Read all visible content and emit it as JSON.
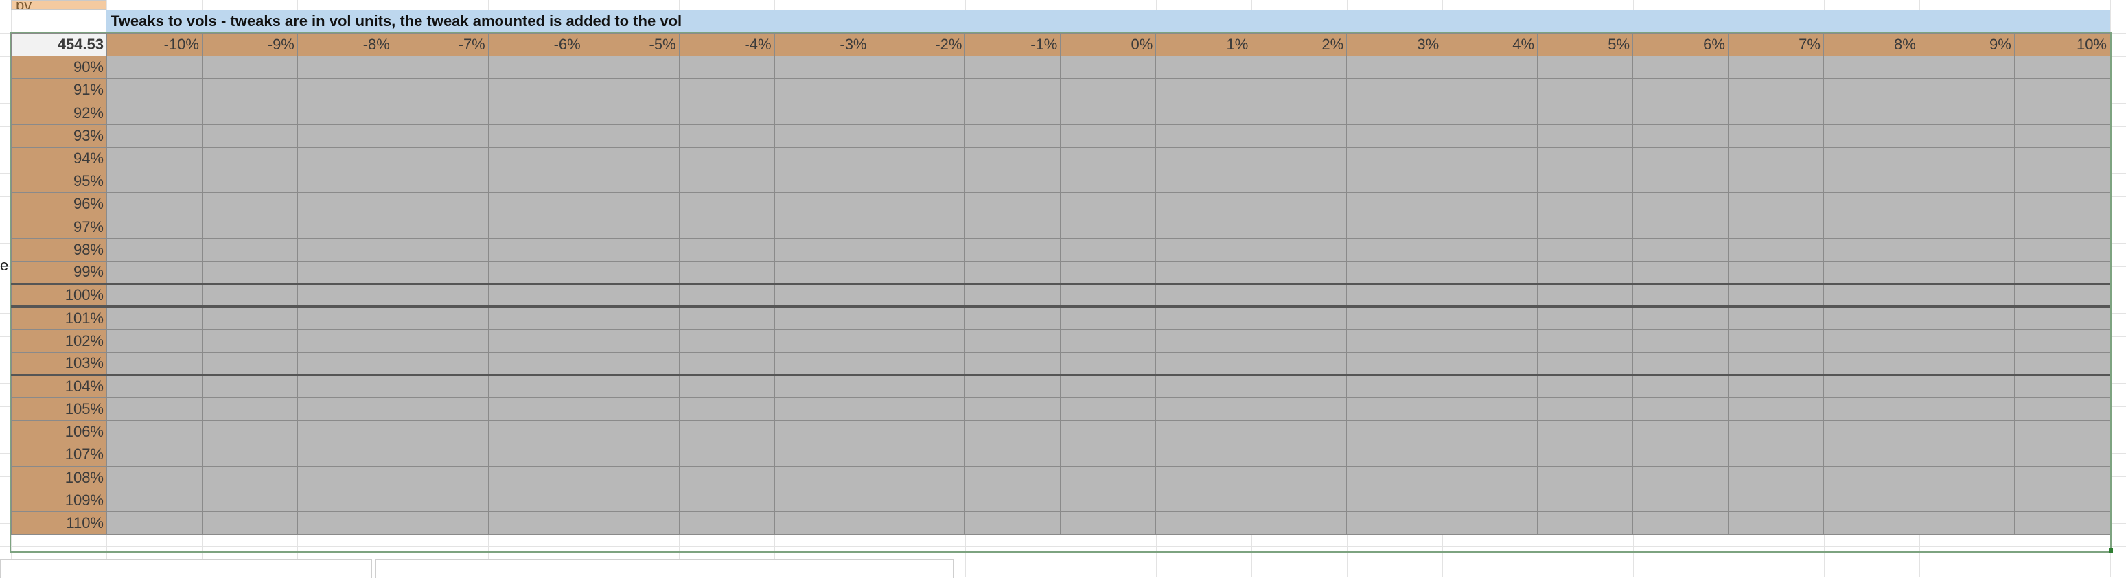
{
  "sheet": {
    "top_cell_label": "pv",
    "side_label": "e",
    "title": "Tweaks to vols - tweaks are in vol units, the tweak amounted is added to the vol",
    "corner_value": "454.53",
    "column_headers": [
      "-10%",
      "-9%",
      "-8%",
      "-7%",
      "-6%",
      "-5%",
      "-4%",
      "-3%",
      "-2%",
      "-1%",
      "0%",
      "1%",
      "2%",
      "3%",
      "4%",
      "5%",
      "6%",
      "7%",
      "8%",
      "9%",
      "10%"
    ],
    "row_headers": [
      "90%",
      "91%",
      "92%",
      "93%",
      "94%",
      "95%",
      "96%",
      "97%",
      "98%",
      "99%",
      "100%",
      "101%",
      "102%",
      "103%",
      "104%",
      "105%",
      "106%",
      "107%",
      "108%",
      "109%",
      "110%"
    ]
  },
  "colors": {
    "header_fill": "#c99b70",
    "cell_fill": "#b8b8b8",
    "title_fill": "#bdd7ee",
    "corner_text": "#f08a12",
    "selection_border": "#7da380"
  }
}
